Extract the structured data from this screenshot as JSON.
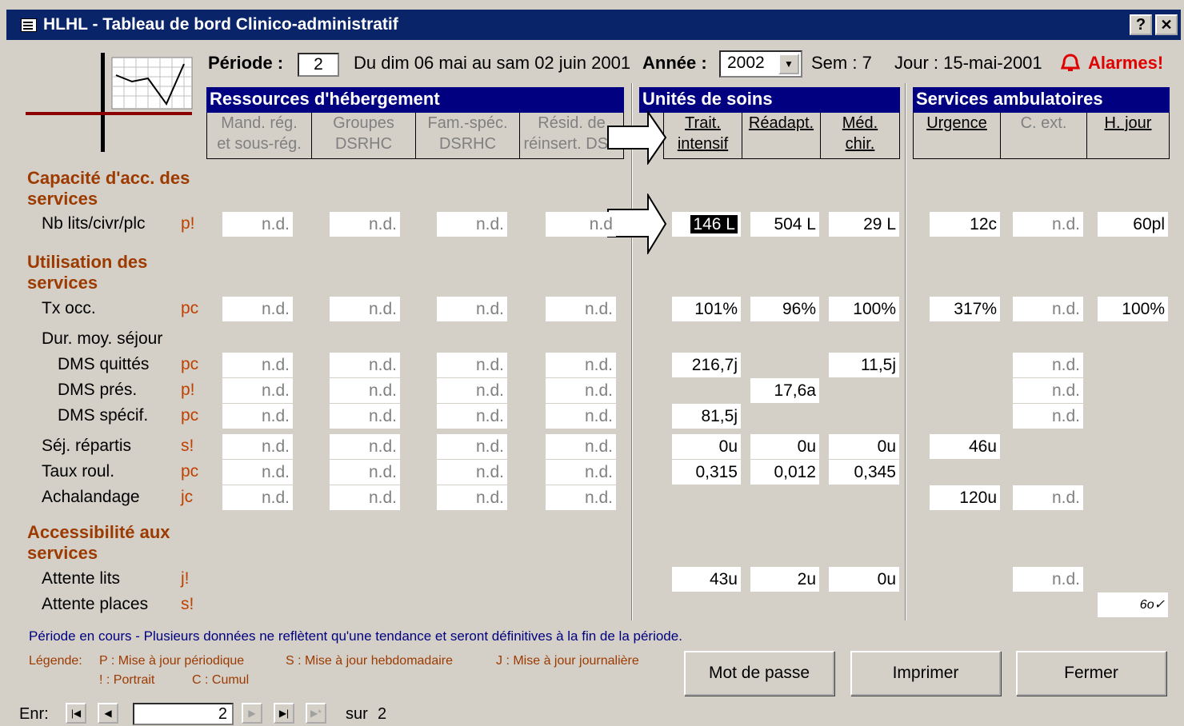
{
  "window": {
    "title": "HLHL - Tableau de bord Clinico-administratif",
    "help_btn": "?",
    "close_btn": "✕"
  },
  "header": {
    "periode_label": "Période :",
    "periode_value": "2",
    "periode_range": "Du dim 06 mai au sam 02 juin 2001",
    "annee_label": "Année :",
    "annee_value": "2002",
    "sem": "Sem : 7",
    "jour": "Jour : 15-mai-2001",
    "alarm": "Alarmes!"
  },
  "sections": {
    "ressources": {
      "title": "Ressources d'hébergement",
      "cols": [
        [
          "Mand. rég.",
          "et sous-rég."
        ],
        [
          "Groupes",
          "DSRHC"
        ],
        [
          "Fam.-spéc.",
          "DSRHC"
        ],
        [
          "Résid. de",
          "réinsert. DSR"
        ]
      ]
    },
    "unites": {
      "title": "Unités de soins",
      "cols": [
        [
          "Trait.",
          "intensif"
        ],
        [
          "Réadapt.",
          ""
        ],
        [
          "Méd.",
          "chir."
        ]
      ]
    },
    "ambul": {
      "title": "Services ambulatoires",
      "cols": [
        [
          "Urgence",
          ""
        ],
        [
          "C. ext.",
          ""
        ],
        [
          "H. jour",
          ""
        ]
      ]
    }
  },
  "categories": {
    "capacite": "Capacité d'acc. des services",
    "utilisation": "Utilisation des services",
    "accessibilite": "Accessibilité aux services"
  },
  "rows": {
    "nblits": {
      "label": "Nb lits/civr/plc",
      "code": "p!",
      "res": [
        "n.d.",
        "n.d.",
        "n.d.",
        "n.d"
      ],
      "uni": [
        "146 L",
        "504 L",
        "29 L"
      ],
      "amb": [
        "12c",
        "n.d.",
        "60pl"
      ]
    },
    "txocc": {
      "label": "Tx occ.",
      "code": "pc",
      "res": [
        "n.d.",
        "n.d.",
        "n.d.",
        "n.d."
      ],
      "uni": [
        "101%",
        "96%",
        "100%"
      ],
      "amb": [
        "317%",
        "n.d.",
        "100%"
      ]
    },
    "dureemoy": {
      "label": "Dur. moy. séjour"
    },
    "dmsq": {
      "label": "DMS quittés",
      "code": "pc",
      "res": [
        "n.d.",
        "n.d.",
        "n.d.",
        "n.d."
      ],
      "uni": [
        "216,7j",
        "",
        "11,5j"
      ],
      "amb": [
        "",
        "n.d.",
        ""
      ]
    },
    "dmsp": {
      "label": "DMS prés.",
      "code": "p!",
      "res": [
        "n.d.",
        "n.d.",
        "n.d.",
        "n.d."
      ],
      "uni": [
        "",
        "17,6a",
        ""
      ],
      "amb": [
        "",
        "n.d.",
        ""
      ]
    },
    "dmss": {
      "label": "DMS spécif.",
      "code": "pc",
      "res": [
        "n.d.",
        "n.d.",
        "n.d.",
        "n.d."
      ],
      "uni": [
        "81,5j",
        "",
        ""
      ],
      "amb": [
        "",
        "n.d.",
        ""
      ]
    },
    "sejrep": {
      "label": "Séj. répartis",
      "code": "s!",
      "res": [
        "n.d.",
        "n.d.",
        "n.d.",
        "n.d."
      ],
      "uni": [
        "0u",
        "0u",
        "0u"
      ],
      "amb": [
        "46u",
        "",
        ""
      ]
    },
    "tauxroul": {
      "label": "Taux roul.",
      "code": "pc",
      "res": [
        "n.d.",
        "n.d.",
        "n.d.",
        "n.d."
      ],
      "uni": [
        "0,315",
        "0,012",
        "0,345"
      ],
      "amb": [
        "",
        "",
        ""
      ]
    },
    "achal": {
      "label": "Achalandage",
      "code": "jc",
      "res": [
        "n.d.",
        "n.d.",
        "n.d.",
        "n.d."
      ],
      "uni": [
        "",
        "",
        ""
      ],
      "amb": [
        "120u",
        "n.d.",
        ""
      ]
    },
    "attlits": {
      "label": "Attente lits",
      "code": "j!",
      "res": [
        "",
        "",
        "",
        ""
      ],
      "uni": [
        "43u",
        "2u",
        "0u"
      ],
      "amb": [
        "",
        "n.d.",
        ""
      ]
    },
    "attplaces": {
      "label": "Attente places",
      "code": "s!",
      "res": [
        "",
        "",
        "",
        ""
      ],
      "uni": [
        "",
        "",
        ""
      ],
      "amb": [
        "",
        "",
        "6o✓"
      ]
    }
  },
  "footer": {
    "note": "Période en cours - Plusieurs données ne reflètent qu'une tendance et seront définitives à la fin de la période.",
    "legend_label": "Légende:",
    "legend_p": "P : Mise à jour périodique",
    "legend_s": "S : Mise à jour hebdomadaire",
    "legend_j": "J : Mise à jour journalière",
    "legend_portrait": "! : Portrait",
    "legend_cumul": "C : Cumul",
    "btn_password": "Mot de passe",
    "btn_print": "Imprimer",
    "btn_close": "Fermer"
  },
  "nav": {
    "label": "Enr:",
    "current": "2",
    "sur": "sur",
    "total": "2"
  },
  "icons": {
    "app": "form-icon",
    "alarm": "alarm-bell-icon",
    "logo": "chart-logo-icon",
    "arrow": "right-arrow-icon"
  }
}
